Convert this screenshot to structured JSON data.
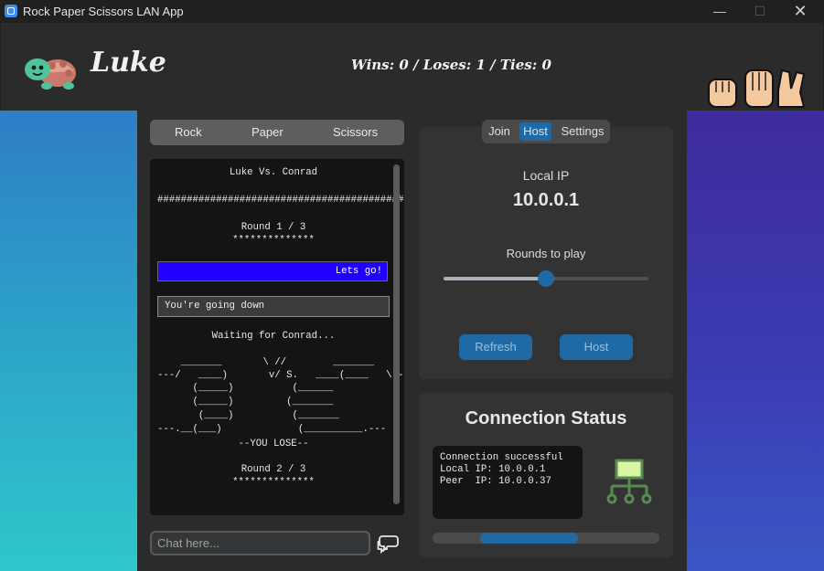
{
  "window": {
    "title": "Rock Paper Scissors LAN App",
    "minimize": "—",
    "maximize": "☐",
    "close": "✕"
  },
  "header": {
    "player_name": "Luke",
    "score": "Wins: 0 / Loses: 1 / Ties: 0"
  },
  "moves": {
    "rock": "Rock",
    "paper": "Paper",
    "scissors": "Scissors"
  },
  "game_log": {
    "title": "Luke Vs. Conrad",
    "divider": "#############################################",
    "round1": "Round 1 / 3",
    "stars": "**************",
    "my_message": "Lets go!",
    "peer_message": "You're going down",
    "waiting": "Waiting for Conrad...",
    "ascii": [
      "    _______       \\ //        _______",
      "---/   ____)       v/ S.   ____(____   \\---",
      "      (_____)          (______",
      "      (_____)         (_______",
      "       (____)          (_______",
      "---.__(___)             (__________.---"
    ],
    "result": "--YOU LOSE--",
    "round2": "Round 2 / 3",
    "stars2": "**************"
  },
  "chat": {
    "placeholder": "Chat here..."
  },
  "tabs": {
    "join": "Join",
    "host": "Host",
    "settings": "Settings",
    "active": "Host"
  },
  "host": {
    "local_ip_label": "Local IP",
    "local_ip": "10.0.0.1",
    "rounds_label": "Rounds to play",
    "rounds_slider_fraction": 0.5,
    "refresh": "Refresh",
    "host_button": "Host"
  },
  "connection": {
    "title": "Connection Status",
    "lines": [
      "Connection successful",
      "Local IP: 10.0.0.1",
      "Peer  IP: 10.0.0.37"
    ],
    "progress_start": 0.21,
    "progress_end": 0.64
  },
  "colors": {
    "accent": "#1f6aa5",
    "my_message_bg": "#2000ff",
    "status_icon": "#5a8a54",
    "status_icon_screen": "#d8f5a0"
  }
}
